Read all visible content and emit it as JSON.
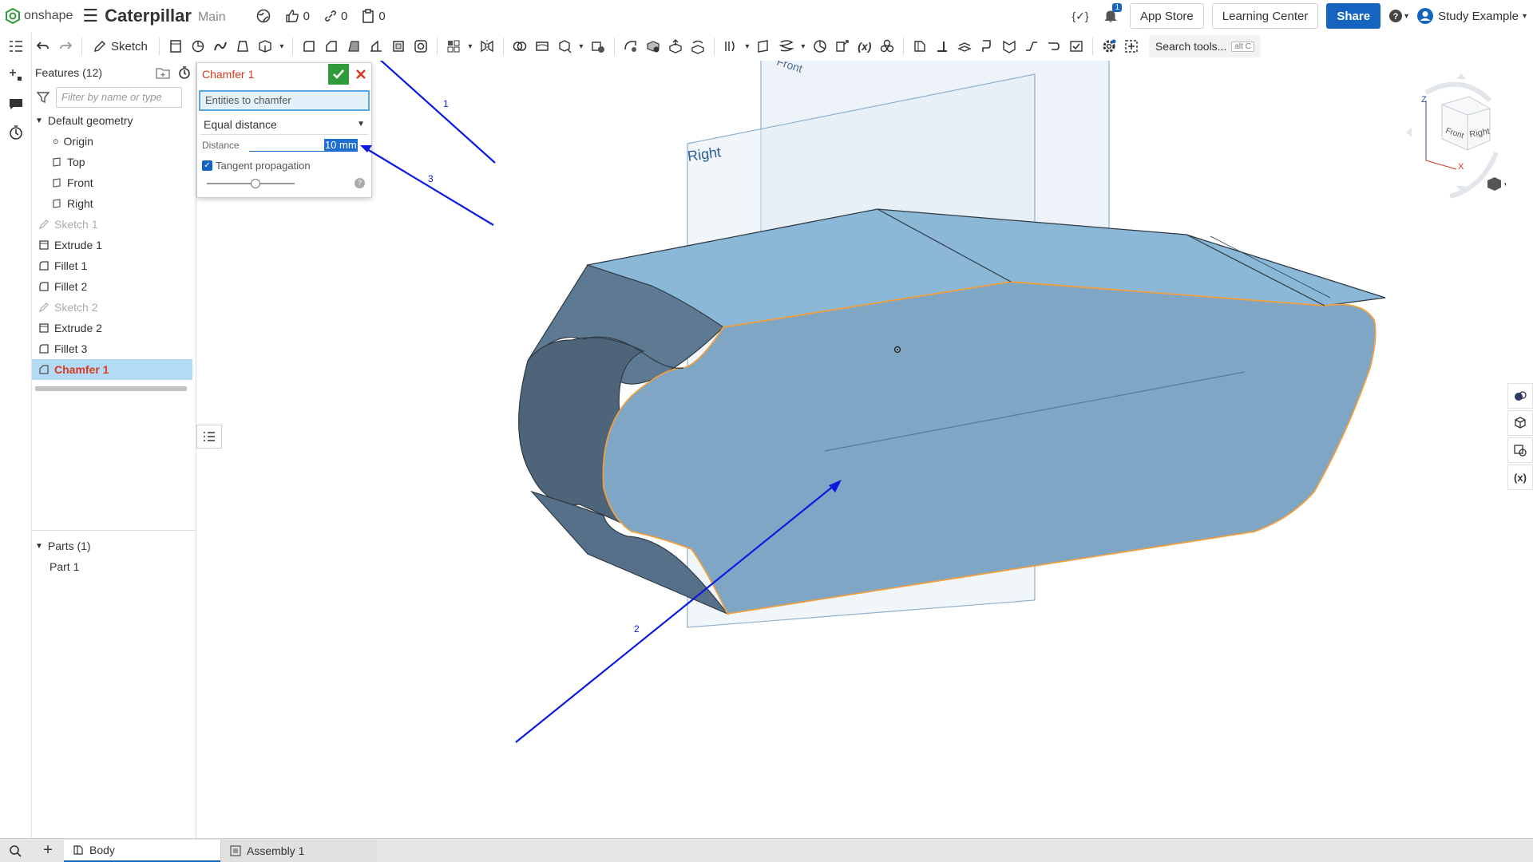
{
  "app": {
    "brand": "onshape",
    "doc_name": "Caterpillar",
    "workspace": "Main"
  },
  "topbar": {
    "likes": "0",
    "links": "0",
    "copies": "0",
    "notifications": "1",
    "app_store": "App Store",
    "learning_center": "Learning Center",
    "share": "Share",
    "user": "Study Example"
  },
  "toolbar": {
    "sketch_label": "Sketch",
    "search_label": "Search tools...",
    "search_kbd": "alt C"
  },
  "features": {
    "header": "Features (12)",
    "filter_placeholder": "Filter by name or type",
    "default_geometry": "Default geometry",
    "geometry_items": [
      "Origin",
      "Top",
      "Front",
      "Right"
    ],
    "items": [
      "Sketch 1",
      "Extrude 1",
      "Fillet 1",
      "Fillet 2",
      "Sketch 2",
      "Extrude 2",
      "Fillet 3",
      "Chamfer 1"
    ],
    "parts_header": "Parts (1)",
    "parts": [
      "Part 1"
    ]
  },
  "dialog": {
    "title": "Chamfer 1",
    "entities_label": "Entities to chamfer",
    "type_value": "Equal distance",
    "distance_label": "Distance",
    "distance_value": "10 mm",
    "tangent_label": "Tangent propagation",
    "tangent_checked": true,
    "slider_level": 0.55
  },
  "viewport": {
    "plane_right": "Right",
    "plane_front": "Front",
    "cube_front": "Front",
    "cube_right": "Right",
    "axis_z": "Z",
    "axis_x": "X",
    "annotations": [
      "1",
      "2",
      "3"
    ]
  },
  "tabs": {
    "body": "Body",
    "assembly": "Assembly 1"
  },
  "colors": {
    "accent": "#1565c0",
    "part_face": "#7fa6c4",
    "part_top": "#8ab8d6",
    "edge_highlight": "#f0a040",
    "selected_text": "#d9381e"
  }
}
